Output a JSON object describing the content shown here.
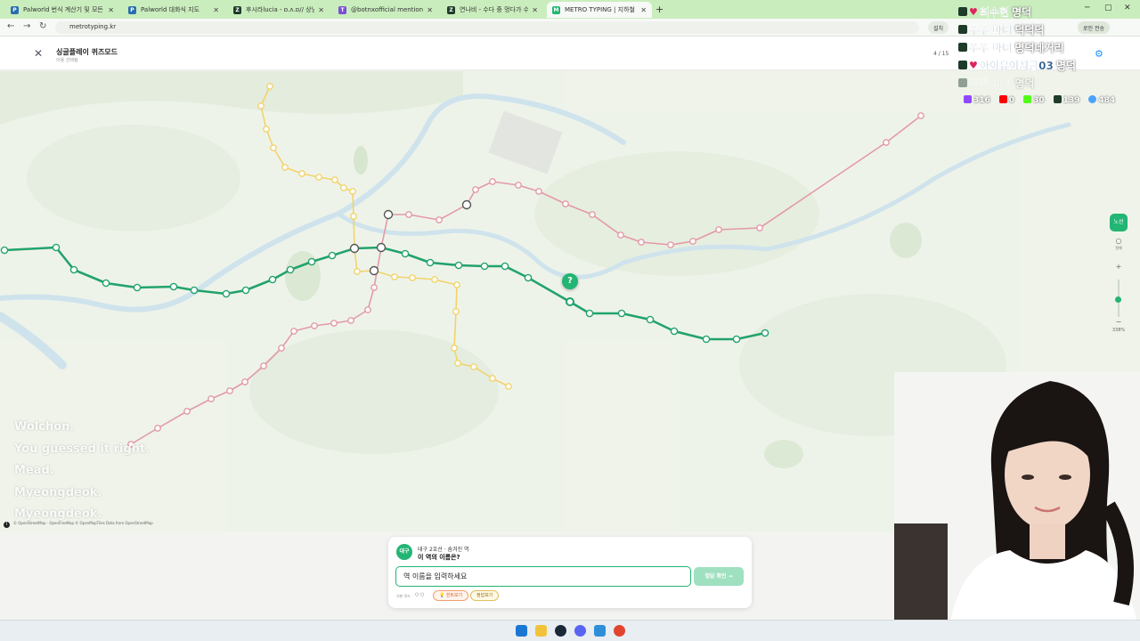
{
  "browser": {
    "tabs": [
      {
        "title": "Palworld 번식 계산기 및 모든",
        "active": false,
        "favicon_color": "#2a6db0",
        "favicon_label": "P"
      },
      {
        "title": "Palworld 대화식 지도",
        "active": false,
        "favicon_color": "#2a6db0",
        "favicon_label": "P"
      },
      {
        "title": "후시라lucia - ɒ.ʌ.ɒ// 상냥하",
        "active": false,
        "favicon_color": "#1f3b2a",
        "favicon_label": "Z"
      },
      {
        "title": "@botnxofficial mentioned",
        "active": false,
        "favicon_color": "#7b4fd6",
        "favicon_label": "T"
      },
      {
        "title": "연나비 - 수다 중 멍다가 수줍",
        "active": false,
        "favicon_color": "#1f3b2a",
        "favicon_label": "Z"
      },
      {
        "title": "METRO TYPING | 지하철 타이",
        "active": true,
        "favicon_color": "#22b573",
        "favicon_label": "M"
      }
    ],
    "url": "metrotyping.kr",
    "install_label": "설치",
    "profile_label": "로인 전송"
  },
  "header": {
    "close_icon": "close-icon",
    "mode_title": "싱글플레이 퀴즈모드",
    "mode_subtitle": "이용 선택됨",
    "progress": "4 / 15",
    "settings_icon": "gear-icon"
  },
  "map": {
    "attribution": "© OpenStreetMap · OpenFreeMap © OpenMapTiles Data from OpenStreetMap",
    "question_pin": "?",
    "accent_color": "#22b573",
    "line2_color": "#22a36b",
    "line1_color": "#e39aa6",
    "line3_color": "#f2d36b"
  },
  "zoom": {
    "toggle_label": "노선",
    "items_label": "전체",
    "level": "338%"
  },
  "subtitles": [
    "Wolchon.",
    "You guessed it right.",
    "Mead.",
    "Myeongdeok.",
    "Myeongdeok."
  ],
  "chat": [
    {
      "user": "최수현",
      "msg": "명덕",
      "heart": true,
      "faded": false
    },
    {
      "user": "쭈쭈 마녀",
      "msg": "덕덕덕",
      "heart": false,
      "faded": false
    },
    {
      "user": "쭈쭈 마녀",
      "msg": "명덕네거리",
      "heart": false,
      "faded": false
    },
    {
      "user": "아이유이지금03",
      "msg": "명덕",
      "heart": true,
      "faded": false
    },
    {
      "user": "쭈쭈 마녀",
      "msg": "명덕",
      "heart": false,
      "faded": true
    }
  ],
  "viewers": [
    {
      "platform": "twitch",
      "count": "316",
      "color": "#9146ff"
    },
    {
      "platform": "youtube",
      "count": "0",
      "color": "#ff0000"
    },
    {
      "platform": "kick",
      "count": "30",
      "color": "#53fc18"
    },
    {
      "platform": "chzzk",
      "count": "139",
      "color": "#1f3b2a"
    },
    {
      "platform": "total",
      "count": "484",
      "color": "#4aa3ff"
    }
  ],
  "quiz": {
    "line_badge": "대구",
    "line_info": "대구 2호선 · 숨겨진 역",
    "question": "이 역의 이름은?",
    "input_value": "역 이름을 입력하세요",
    "submit_label": "정답 확인 →",
    "hint_label": "기본 모드",
    "dots": "○ ○",
    "hint_button": "힌트보기",
    "answer_button": "정답보기"
  }
}
